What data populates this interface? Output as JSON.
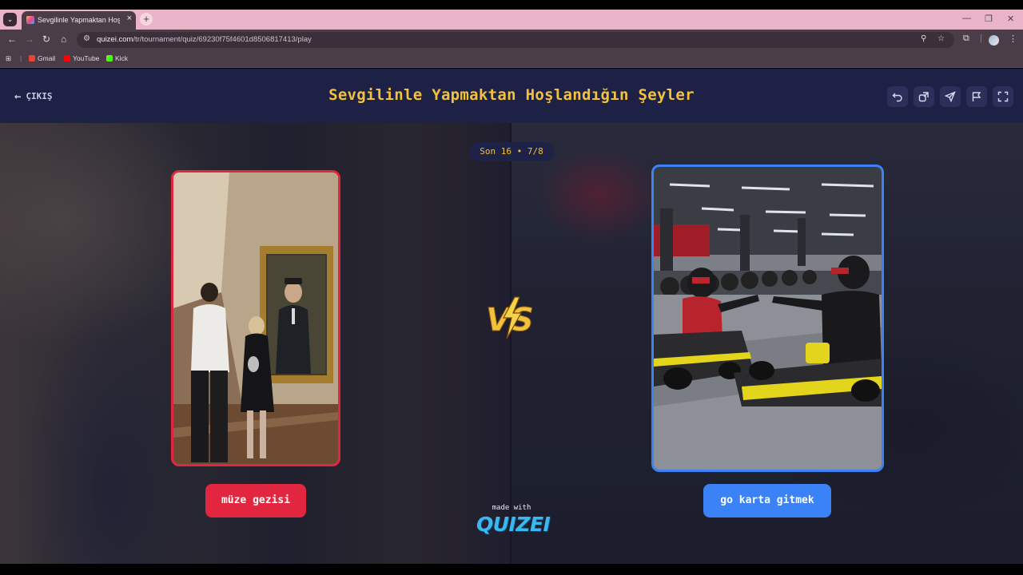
{
  "browser": {
    "tab_title": "Sevgilinle Yapmaktan Hoşlandı",
    "url_domain": "quizei.com",
    "url_path": "/tr/tournament/quiz/69230f75f4601d8506817413/play",
    "bookmarks": [
      {
        "label": "Gmail",
        "color": "#ea4335"
      },
      {
        "label": "YouTube",
        "color": "#ff0000"
      },
      {
        "label": "Kick",
        "color": "#53fc18"
      }
    ]
  },
  "header": {
    "exit_label": "ÇIKIŞ",
    "title": "Sevgilinle Yapmaktan Hoşlandığın Şeyler",
    "actions": [
      "undo-icon",
      "share-icon",
      "send-icon",
      "flag-icon",
      "fullscreen-icon"
    ]
  },
  "round": {
    "label": "Son 16 • 7/8"
  },
  "options": {
    "left": {
      "label": "müze gezisi",
      "color": "#e3263f"
    },
    "right": {
      "label": "go karta gitmek",
      "color": "#3b82f6"
    }
  },
  "vs_label": "VS",
  "footer": {
    "made_with": "made with",
    "brand": "QUIZEI"
  },
  "colors": {
    "title": "#f2c23d",
    "header_bg": "#1e2146",
    "left_accent": "#e3263f",
    "right_accent": "#3b82f6"
  }
}
